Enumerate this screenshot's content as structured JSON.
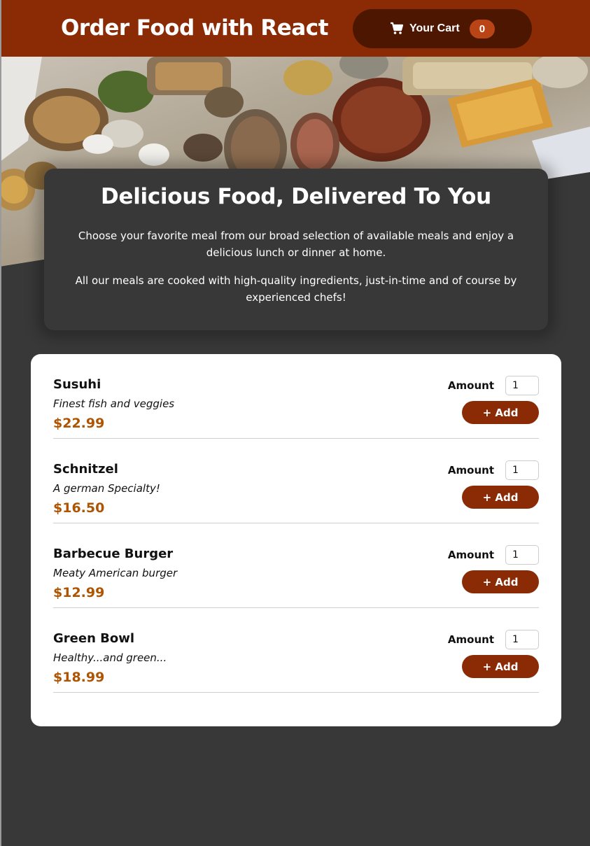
{
  "header": {
    "title": "Order Food with React",
    "cart": {
      "label": "Your Cart",
      "count": "0",
      "icon": "cart-icon"
    }
  },
  "summary": {
    "heading": "Delicious Food, Delivered To You",
    "paragraph_1": "Choose your favorite meal from our broad selection of available meals and enjoy a delicious lunch or dinner at home.",
    "paragraph_2": "All our meals are cooked with high-quality ingredients, just-in-time and of course by experienced chefs!"
  },
  "meals": [
    {
      "name": "Susuhi",
      "description": "Finest fish and veggies",
      "price": "$22.99",
      "amount_label": "Amount",
      "amount_value": "1",
      "add_label": "+ Add"
    },
    {
      "name": "Schnitzel",
      "description": "A german Specialty!",
      "price": "$16.50",
      "amount_label": "Amount",
      "amount_value": "1",
      "add_label": "+ Add"
    },
    {
      "name": "Barbecue Burger",
      "description": "Meaty American burger",
      "price": "$12.99",
      "amount_label": "Amount",
      "amount_value": "1",
      "add_label": "+ Add"
    },
    {
      "name": "Green Bowl",
      "description": "Healthy...and green...",
      "price": "$18.99",
      "amount_label": "Amount",
      "amount_value": "1",
      "add_label": "+ Add"
    }
  ],
  "colors": {
    "header_bg": "#8a2b06",
    "cart_button_bg": "#4d1601",
    "cart_badge_bg": "#b94517",
    "page_bg": "#383838",
    "price": "#ad5502",
    "add_button_bg": "#8a2b06"
  }
}
